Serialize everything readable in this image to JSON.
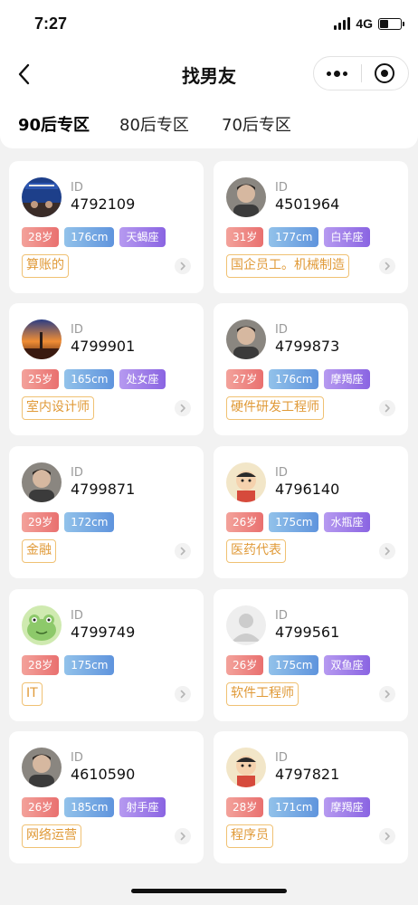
{
  "status_bar": {
    "time": "7:27",
    "network": "4G",
    "battery_level": 0.4
  },
  "nav": {
    "title": "找男友",
    "more_icon": "ellipsis-icon",
    "close_icon": "target-icon"
  },
  "tabs": [
    {
      "label": "90后专区",
      "active": true
    },
    {
      "label": "80后专区",
      "active": false
    },
    {
      "label": "70后专区",
      "active": false
    }
  ],
  "cards": [
    {
      "id_label": "ID",
      "id": "4792109",
      "age": "28岁",
      "height": "176cm",
      "zodiac": "天蝎座",
      "job": "算账的",
      "avatar": "certificate-photo"
    },
    {
      "id_label": "ID",
      "id": "4501964",
      "age": "31岁",
      "height": "177cm",
      "zodiac": "白羊座",
      "job": "国企员工。机械制造",
      "avatar": "portrait-photo"
    },
    {
      "id_label": "ID",
      "id": "4799901",
      "age": "25岁",
      "height": "165cm",
      "zodiac": "处女座",
      "job": "室内设计师",
      "avatar": "sunset-photo"
    },
    {
      "id_label": "ID",
      "id": "4799873",
      "age": "27岁",
      "height": "176cm",
      "zodiac": "摩羯座",
      "job": "硬件研发工程师",
      "avatar": "portrait-photo"
    },
    {
      "id_label": "ID",
      "id": "4799871",
      "age": "29岁",
      "height": "172cm",
      "zodiac": "",
      "job": "金融",
      "avatar": "portrait-photo"
    },
    {
      "id_label": "ID",
      "id": "4796140",
      "age": "26岁",
      "height": "175cm",
      "zodiac": "水瓶座",
      "job": "医药代表",
      "avatar": "cartoon-photo"
    },
    {
      "id_label": "ID",
      "id": "4799749",
      "age": "28岁",
      "height": "175cm",
      "zodiac": "",
      "job": "IT",
      "avatar": "frog-photo"
    },
    {
      "id_label": "ID",
      "id": "4799561",
      "age": "26岁",
      "height": "175cm",
      "zodiac": "双鱼座",
      "job": "软件工程师",
      "avatar": "default-avatar"
    },
    {
      "id_label": "ID",
      "id": "4610590",
      "age": "26岁",
      "height": "185cm",
      "zodiac": "射手座",
      "job": "网络运营",
      "avatar": "portrait-photo"
    },
    {
      "id_label": "ID",
      "id": "4797821",
      "age": "28岁",
      "height": "171cm",
      "zodiac": "摩羯座",
      "job": "程序员",
      "avatar": "cartoon-photo"
    }
  ]
}
